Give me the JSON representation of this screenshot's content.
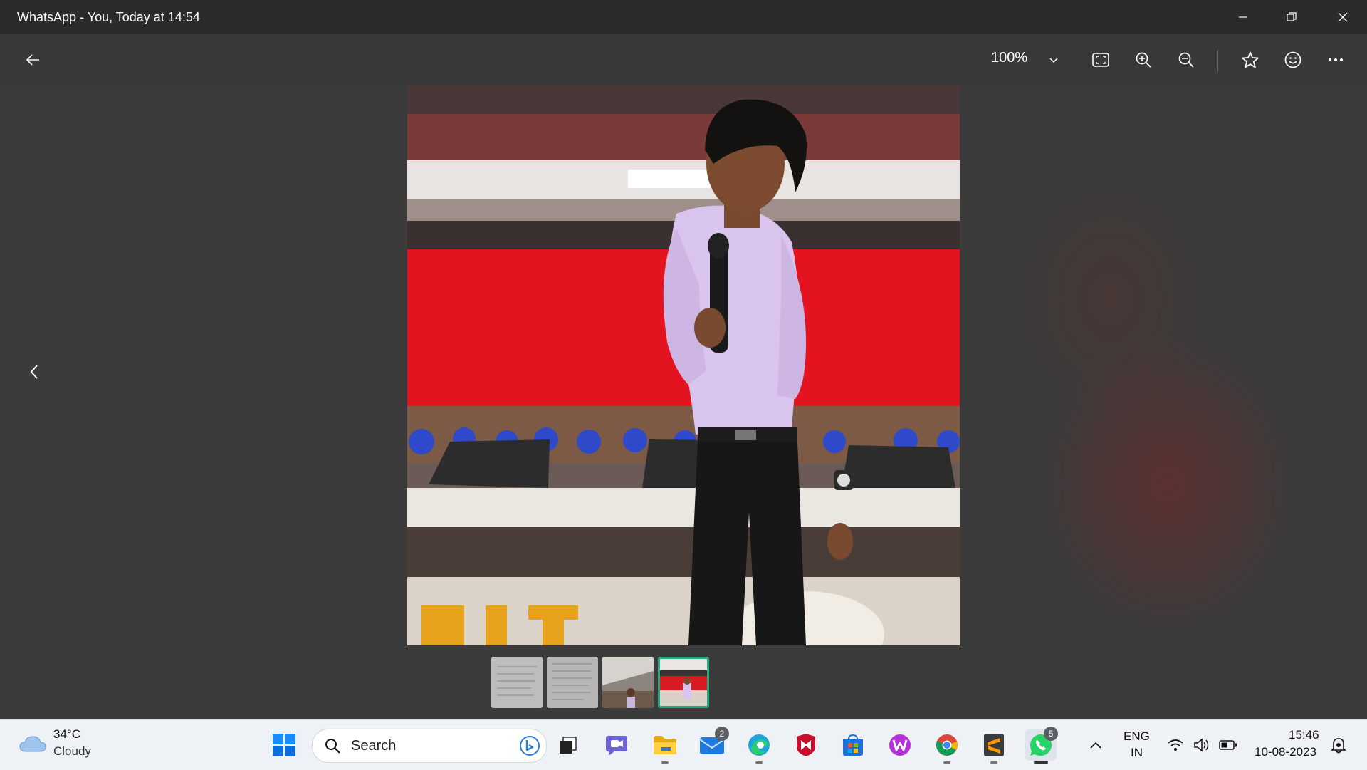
{
  "window": {
    "title": "WhatsApp - You, Today at 14:54"
  },
  "toolbar": {
    "zoom_level": "100%",
    "icons": [
      "back-arrow-icon",
      "chevron-down-icon",
      "fit-to-window-icon",
      "zoom-in-icon",
      "zoom-out-icon",
      "star-icon",
      "smiley-icon",
      "more-icon"
    ]
  },
  "filmstrip": {
    "count": 4,
    "selected_index": 3
  },
  "taskbar": {
    "weather_temp": "34°C",
    "weather_condition": "Cloudy",
    "search_label": "Search",
    "mail_badge": "2",
    "whatsapp_badge": "5",
    "lang_line1": "ENG",
    "lang_line2": "IN",
    "time": "15:46",
    "date": "10-08-2023",
    "accent": "#0078d4"
  }
}
